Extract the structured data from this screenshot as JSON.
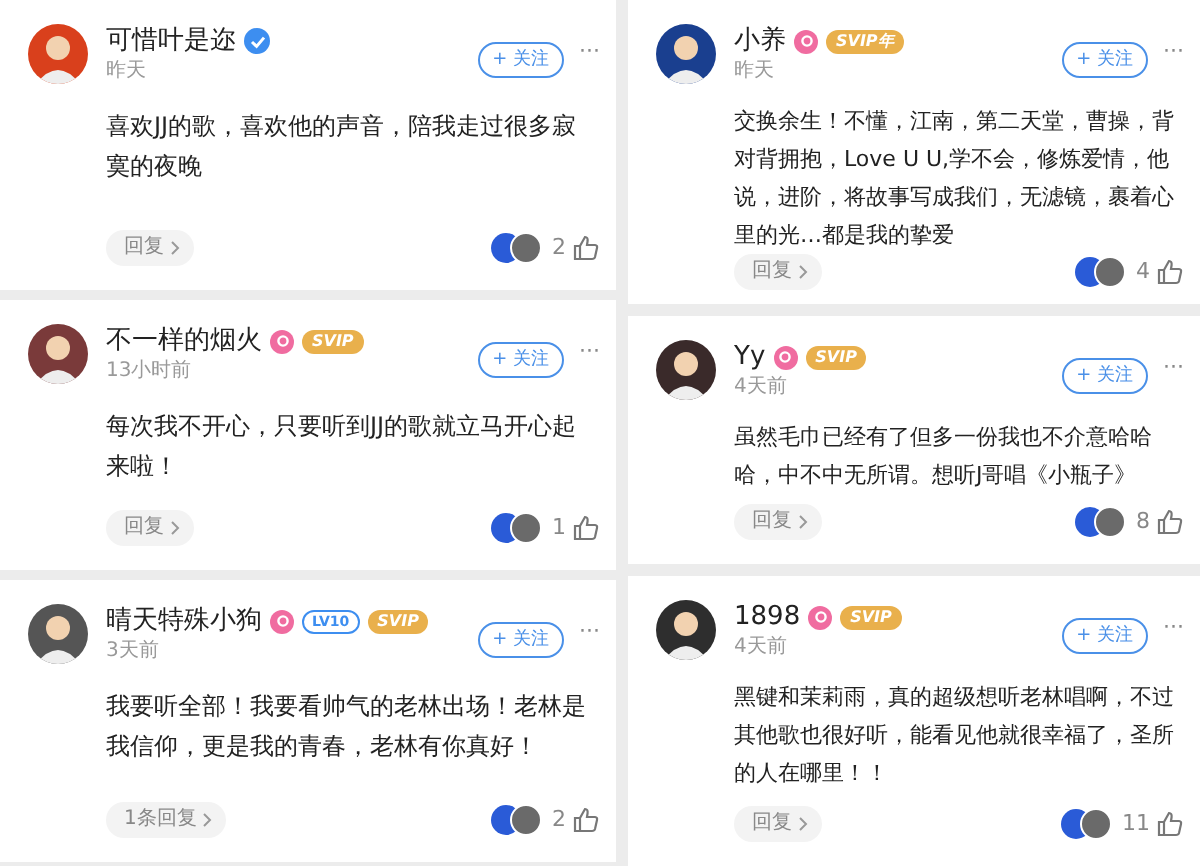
{
  "columns": [
    {
      "comments": [
        {
          "user": "可惜叶是迩",
          "badges": [
            {
              "kind": "verified"
            }
          ],
          "time": "昨天",
          "follow": "+ 关注",
          "more": "···",
          "text": "喜欢JJ的歌，喜欢他的声音，陪我走过很多寂寞的夜晚",
          "reply": "回复",
          "likes": "2"
        },
        {
          "user": "不一样的烟火",
          "badges": [
            {
              "kind": "pink"
            },
            {
              "kind": "svip",
              "label": "SVIP"
            }
          ],
          "time": "13小时前",
          "follow": "+ 关注",
          "more": "···",
          "text": "每次我不开心，只要听到JJ的歌就立马开心起来啦！",
          "reply": "回复",
          "likes": "1"
        },
        {
          "user": "晴天特殊小狗",
          "badges": [
            {
              "kind": "pink"
            },
            {
              "kind": "level",
              "label": "LV10"
            },
            {
              "kind": "svip",
              "label": "SVIP"
            }
          ],
          "time": "3天前",
          "follow": "+ 关注",
          "more": "···",
          "text": "我要听全部！我要看帅气的老林出场！老林是我信仰，更是我的青春，老林有你真好！",
          "reply": "1条回复",
          "likes": "2"
        }
      ]
    },
    {
      "comments": [
        {
          "user": "小养",
          "badges": [
            {
              "kind": "pink"
            },
            {
              "kind": "svip",
              "label": "SVIP年"
            }
          ],
          "time": "昨天",
          "follow": "+ 关注",
          "more": "···",
          "text": "交换余生！不懂，江南，第二天堂，曹操，背对背拥抱，Love U U,学不会，修炼爱情，他说，进阶，将故事写成我们，无滤镜，裹着心里的光…都是我的挚爱",
          "reply": "回复",
          "likes": "4"
        },
        {
          "user": "Yy",
          "badges": [
            {
              "kind": "pink"
            },
            {
              "kind": "svip",
              "label": "SVIP"
            }
          ],
          "time": "4天前",
          "follow": "+ 关注",
          "more": "···",
          "text": "虽然毛巾已经有了但多一份我也不介意哈哈哈，中不中无所谓。想听J哥唱《小瓶子》",
          "reply": "回复",
          "likes": "8"
        },
        {
          "user": "1898",
          "badges": [
            {
              "kind": "pink"
            },
            {
              "kind": "svip",
              "label": "SVIP"
            }
          ],
          "time": "4天前",
          "follow": "+ 关注",
          "more": "···",
          "text": "黑键和茉莉雨，真的超级想听老林唱啊，不过其他歌也很好听，能看见他就很幸福了，圣所的人在哪里！！",
          "reply": "回复",
          "likes": "11"
        }
      ]
    }
  ]
}
